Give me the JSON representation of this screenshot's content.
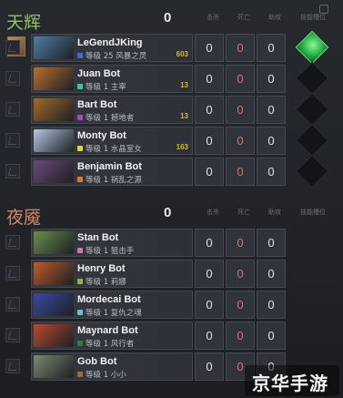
{
  "columns": {
    "kills_label": "击杀",
    "deaths_label": "死亡",
    "assists_label": "助攻",
    "slot_label": "技能槽位"
  },
  "radiant": {
    "name": "天辉",
    "score": "0",
    "players": [
      {
        "name": "LeGendJKing",
        "level": "等级 25 风暴之灵",
        "badge": "603",
        "dot": "#3b6fd8",
        "k": "0",
        "d": "0",
        "a": "0",
        "portrait": "#4f7fa2"
      },
      {
        "name": "Juan Bot",
        "level": "等级 1 主宰",
        "badge": "13",
        "dot": "#36c9a0",
        "k": "0",
        "d": "0",
        "a": "0",
        "portrait": "#b8702e"
      },
      {
        "name": "Bart Bot",
        "level": "等级 1 撼地者",
        "badge": "13",
        "dot": "#b040c8",
        "k": "0",
        "d": "0",
        "a": "0",
        "portrait": "#a36b26"
      },
      {
        "name": "Monty Bot",
        "level": "等级 1 水晶室女",
        "badge": "163",
        "dot": "#e0d040",
        "k": "0",
        "d": "0",
        "a": "0",
        "portrait": "#b7c6e0"
      },
      {
        "name": "Benjamin Bot",
        "level": "等级 1 祸乱之源",
        "badge": "",
        "dot": "#e07a20",
        "k": "0",
        "d": "0",
        "a": "0",
        "portrait": "#6c4a78"
      }
    ]
  },
  "dire": {
    "name": "夜魇",
    "score": "0",
    "players": [
      {
        "name": "Stan Bot",
        "level": "等级 1 狙击手",
        "dot": "#e070b0",
        "k": "0",
        "d": "0",
        "a": "0",
        "portrait": "#6a8f4e"
      },
      {
        "name": "Henry Bot",
        "level": "等级 1 莉娜",
        "dot": "#90b840",
        "k": "0",
        "d": "0",
        "a": "0",
        "portrait": "#c05a2a"
      },
      {
        "name": "Mordecai Bot",
        "level": "等级 1 复仇之魂",
        "dot": "#60c0e0",
        "k": "0",
        "d": "0",
        "a": "0",
        "portrait": "#3a4aa0"
      },
      {
        "name": "Maynard Bot",
        "level": "等级 1 风行者",
        "dot": "#2a8040",
        "k": "0",
        "d": "0",
        "a": "0",
        "portrait": "#b84a30"
      },
      {
        "name": "Gob Bot",
        "level": "等级 1 小小",
        "dot": "#a06a30",
        "k": "0",
        "d": "0",
        "a": "0",
        "portrait": "#7a8a70"
      }
    ]
  },
  "watermark": "京华手游",
  "colors": {
    "radiant": "#8cc36b",
    "dire": "#d08a6a"
  }
}
